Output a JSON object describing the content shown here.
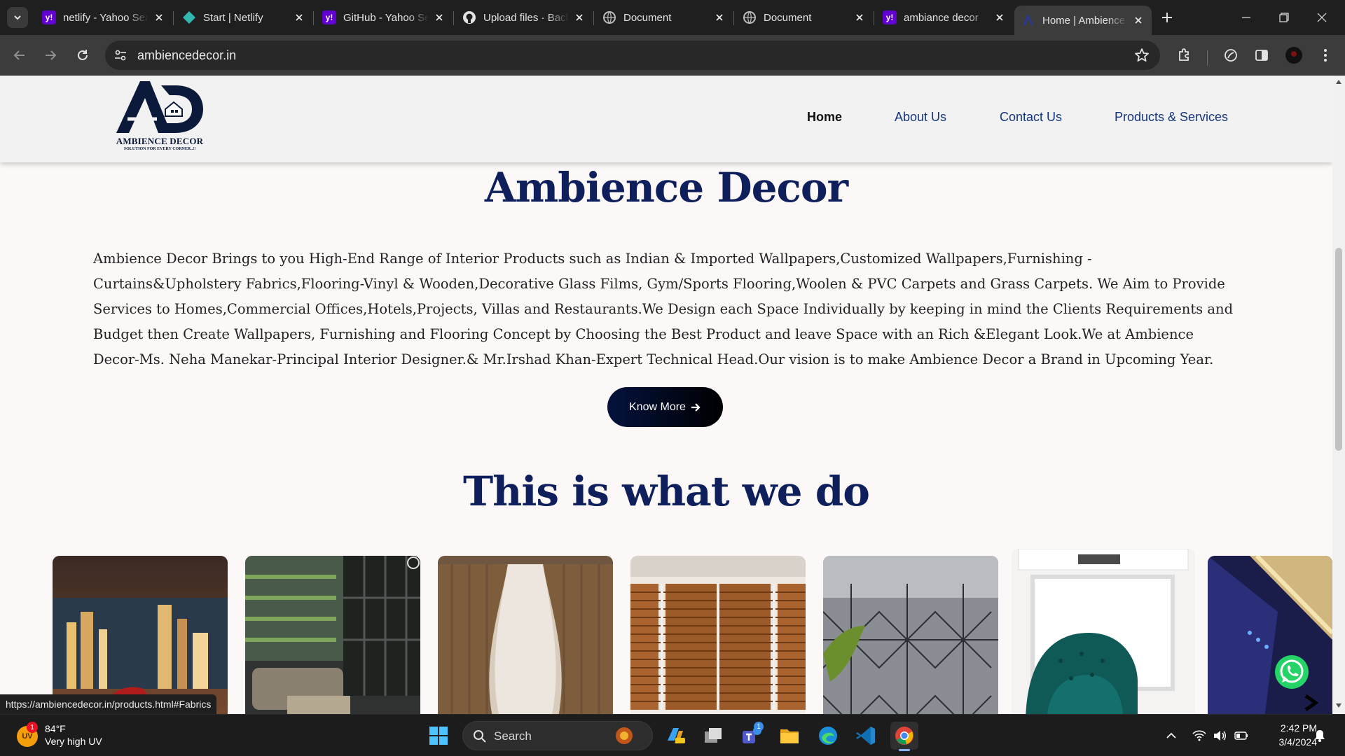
{
  "browser": {
    "tabs": [
      {
        "title": "netlify - Yahoo Search",
        "favicon": "yahoo-icon",
        "active": false
      },
      {
        "title": "Start | Netlify",
        "favicon": "netlify-icon",
        "active": false
      },
      {
        "title": "GitHub - Yahoo Search",
        "favicon": "yahoo-icon",
        "active": false
      },
      {
        "title": "Upload files · Back",
        "favicon": "github-icon",
        "active": false
      },
      {
        "title": "Document",
        "favicon": "globe-icon",
        "active": false
      },
      {
        "title": "Document",
        "favicon": "globe-icon",
        "active": false
      },
      {
        "title": "ambiance decor",
        "favicon": "yahoo-icon",
        "active": false
      },
      {
        "title": "Home | Ambience",
        "favicon": "ambience-icon",
        "active": true
      }
    ],
    "url": "ambiencedecor.in",
    "status_url": "https://ambiencedecor.in/products.html#Fabrics"
  },
  "site": {
    "logo": {
      "monogram": "AD",
      "brand": "AMBIENCE DECOR",
      "tagline": "SOLUTION FOR EVERY CORNER..!!"
    },
    "nav": {
      "home": "Home",
      "about": "About Us",
      "contact": "Contact Us",
      "products": "Products & Services"
    },
    "hero_title": "Ambience Decor",
    "intro": "Ambience Decor Brings to you High-End Range of Interior Products such as Indian & Imported Wallpapers,Customized Wallpapers,Furnishing -Curtains&Upholstery Fabrics,Flooring-Vinyl & Wooden,Decorative Glass Films, Gym/Sports Flooring,Woolen & PVC Carpets and Grass Carpets. We Aim to Provide Services to Homes,Commercial Offices,Hotels,Projects, Villas and Restaurants.We Design each Space Individually by keeping in mind the Clients Requirements and Budget then Create Wallpapers, Furnishing and Flooring Concept by Choosing the Best Product and leave Space with an Rich &Elegant Look.We at Ambience Decor-Ms. Neha Manekar-Principal Interior Designer.& Mr.Irshad Khan-Expert Technical Head.Our vision is to make Ambience Decor a Brand in Upcoming Year.",
    "know_more": "Know More",
    "section_title": "This is what we do"
  },
  "taskbar": {
    "weather": {
      "temp": "84°F",
      "desc": "Very high UV",
      "badge": "1",
      "icon_text": "UV"
    },
    "search_label": "Search",
    "teams_badge": "1",
    "time": "2:42 PM",
    "date": "3/4/2024"
  },
  "colors": {
    "navy": "#0e1f5c",
    "nav_link": "#15367a",
    "page_bg": "#fbf8f7"
  }
}
